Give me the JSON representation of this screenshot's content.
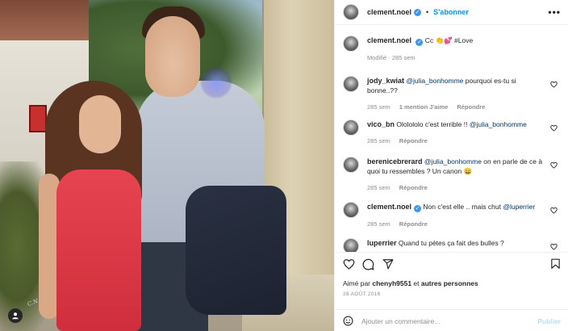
{
  "photo": {
    "watermark": "C.N"
  },
  "header": {
    "username": "clement.noel",
    "separator": "•",
    "follow_label": "S'abonner",
    "more_label": "•••"
  },
  "caption": {
    "username": "clement.noel",
    "text": "Cc 👏💕 #Love",
    "meta": "Modifié · 285 sem"
  },
  "comments": [
    {
      "username": "jody_kwiat",
      "parts": [
        {
          "t": "mention",
          "v": "@julia_bonhomme"
        },
        {
          "t": "text",
          "v": " pourquoi es-tu si bonne..??"
        }
      ],
      "time": "285 sem",
      "likes": "1 mention J'aime",
      "reply": "Répondre"
    },
    {
      "username": "vico_bn",
      "parts": [
        {
          "t": "text",
          "v": "Ololololo c'est terrible !! "
        },
        {
          "t": "mention",
          "v": "@julia_bonhomme"
        }
      ],
      "time": "285 sem",
      "likes": "",
      "reply": "Répondre"
    },
    {
      "username": "berenicebrerard",
      "parts": [
        {
          "t": "mention",
          "v": "@julia_bonhomme"
        },
        {
          "t": "text",
          "v": " on en parle de ce à quoi tu ressembles ? Un canon 😄"
        }
      ],
      "time": "285 sem",
      "likes": "",
      "reply": "Répondre"
    },
    {
      "username": "clement.noel",
      "parts": [
        {
          "t": "text",
          "v": "Non c'est elle .. mais chut "
        },
        {
          "t": "mention",
          "v": "@luperrier"
        }
      ],
      "time": "285 sem",
      "likes": "",
      "reply": "Répondre"
    },
    {
      "username": "luperrier",
      "parts": [
        {
          "t": "text",
          "v": "Quand tu pètes ça fait des bulles ?"
        }
      ],
      "time": "",
      "likes": "",
      "reply": ""
    }
  ],
  "actions": {
    "liked_by_prefix": "Aimé par ",
    "liked_by_user": "chenyh9551",
    "liked_by_suffix": " et ",
    "liked_by_others": "autres personnes",
    "date": "28 AOÛT 2016"
  },
  "add_comment": {
    "placeholder": "Ajouter un commentaire...",
    "post_label": "Publier"
  },
  "colors": {
    "accent": "#0095f6",
    "verified": "#3897f0",
    "muted": "#8e8e8e",
    "post_disabled": "#b2dffc"
  }
}
